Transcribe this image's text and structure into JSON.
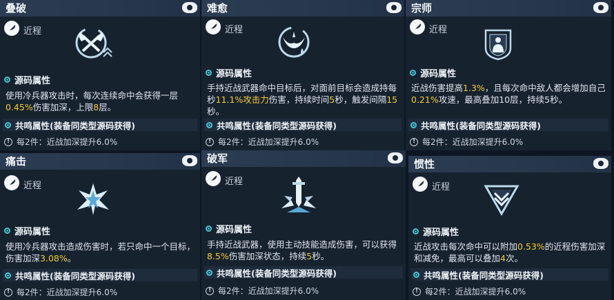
{
  "cards": [
    {
      "title": "叠破",
      "tag": "近程",
      "section": "源码属性",
      "desc": [
        "使用冷兵器攻击时，每次连续命中会获得一层",
        "0.45%",
        "伤害加深，上限",
        "8",
        "层。"
      ],
      "resonance": "共鸣属性(装备同类型源码获得)",
      "bonus": "每2件：近战加深提升6.0%",
      "icon": "crossed-wings-icon"
    },
    {
      "title": "难愈",
      "tag": "近程",
      "section": "源码属性",
      "desc": [
        "手持近战武器命中目标后，对面前目标会造成持每秒",
        "11.1%攻击力",
        "伤害，持续时间",
        "5",
        "秒，触发间隔",
        "15",
        "秒。"
      ],
      "resonance": "共鸣属性(装备同类型源码获得)",
      "bonus": "每2件：近战加深提升6.0%",
      "icon": "bleeding-wing-icon"
    },
    {
      "title": "宗师",
      "tag": "近程",
      "section": "源码属性",
      "desc": [
        "近战伤害提高",
        "1.3%",
        "，且每次命中敌人都会增加自己",
        "0.21%",
        "攻速，最高叠加10层，持续5秒。"
      ],
      "resonance": "共鸣属性(装备同类型源码获得)",
      "bonus": "每2件：近战加深提升6.0%",
      "icon": "master-shield-icon"
    },
    {
      "title": "痛击",
      "tag": "近程",
      "section": "源码属性",
      "desc": [
        "使用冷兵器攻击造成伤害时，若只命中一个目标，伤害加深",
        "3.08%",
        "。"
      ],
      "resonance": "共鸣属性(装备同类型源码获得)",
      "bonus": "每2件：近战加深提升6.0%",
      "icon": "impact-burst-icon"
    },
    {
      "title": "破军",
      "tag": "近程",
      "section": "源码属性",
      "desc": [
        "手持近战武器，使用主动技能造成伤害，可以获得",
        "8.5%",
        "伤害加深状态，持续",
        "5",
        "秒。"
      ],
      "resonance": "共鸣属性(装备同类型源码获得)",
      "bonus": "每2件：近战加深提升6.0%",
      "icon": "sword-burst-icon"
    },
    {
      "title": "惯性",
      "tag": "近程",
      "section": "源码属性",
      "desc": [
        "近战攻击每次命中可以附加",
        "0.53%",
        "的近程伤害加深和减免，最高可以叠加",
        "4",
        "次。"
      ],
      "resonance": "共鸣属性(装备同类型源码获得)",
      "bonus": "每2件：近战加深提升6.0%",
      "icon": "chevron-triangle-icon"
    }
  ]
}
